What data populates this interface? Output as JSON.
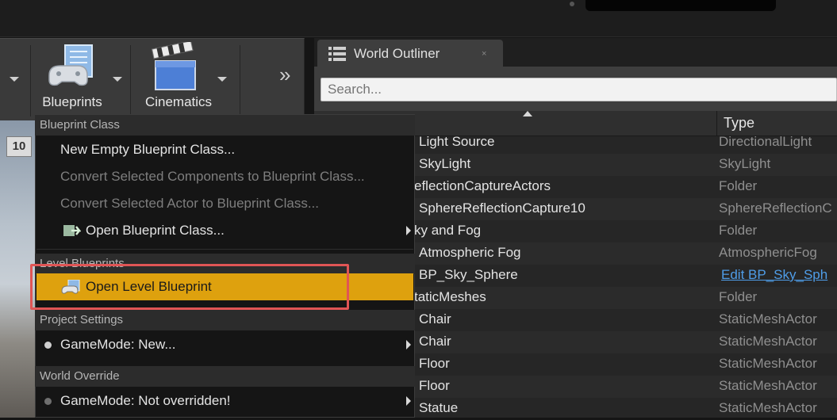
{
  "toolbar": {
    "blueprints_label": "Blueprints",
    "cinematics_label": "Cinematics",
    "overflow_glyph": "»"
  },
  "viewport": {
    "badge": "10"
  },
  "outliner": {
    "tab_title": "World Outliner",
    "close_glyph": "×",
    "search_placeholder": "Search...",
    "type_header": "Type",
    "rows": [
      {
        "name": "Light Source",
        "type": "DirectionalLight",
        "folder": false,
        "link": false
      },
      {
        "name": "SkyLight",
        "type": "SkyLight",
        "folder": false,
        "link": false
      },
      {
        "name": "eflectionCaptureActors",
        "type": "Folder",
        "folder": true,
        "link": false
      },
      {
        "name": "SphereReflectionCapture10",
        "type": "SphereReflectionC",
        "folder": false,
        "link": false
      },
      {
        "name": "ky and Fog",
        "type": "Folder",
        "folder": true,
        "link": false
      },
      {
        "name": "Atmospheric Fog",
        "type": "AtmosphericFog",
        "folder": false,
        "link": false
      },
      {
        "name": "BP_Sky_Sphere",
        "type": "Edit BP_Sky_Sph",
        "folder": false,
        "link": true
      },
      {
        "name": "taticMeshes",
        "type": "Folder",
        "folder": true,
        "link": false
      },
      {
        "name": "Chair",
        "type": "StaticMeshActor",
        "folder": false,
        "link": false
      },
      {
        "name": "Chair",
        "type": "StaticMeshActor",
        "folder": false,
        "link": false
      },
      {
        "name": "Floor",
        "type": "StaticMeshActor",
        "folder": false,
        "link": false
      },
      {
        "name": "Floor",
        "type": "StaticMeshActor",
        "folder": false,
        "link": false
      },
      {
        "name": "Statue",
        "type": "StaticMeshActor",
        "folder": false,
        "link": false
      }
    ]
  },
  "menu": {
    "blueprint_class_header": "Blueprint Class",
    "new_empty": "New Empty Blueprint Class...",
    "convert_components": "Convert Selected Components to Blueprint Class...",
    "convert_actor": "Convert Selected Actor to Blueprint Class...",
    "open_class": "Open Blueprint Class...",
    "level_header": "Level Blueprints",
    "open_level": "Open Level Blueprint",
    "project_header": "Project Settings",
    "gamemode_new": "GameMode: New...",
    "world_header": "World Override",
    "gamemode_override": "GameMode: Not overridden!"
  },
  "colors": {
    "highlight": "#dea10e",
    "callout": "#e05555",
    "link": "#4f9de8"
  }
}
